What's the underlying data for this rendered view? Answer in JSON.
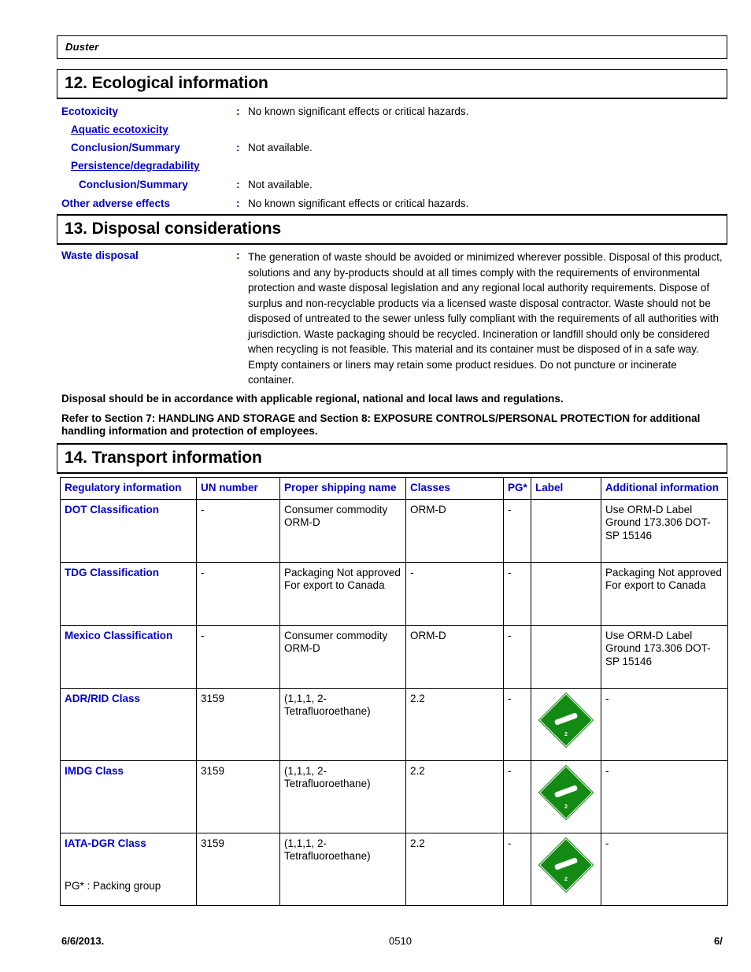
{
  "document": {
    "running_header_title": "Duster"
  },
  "sections": {
    "ecological": {
      "heading": "12. Ecological information",
      "rows": [
        {
          "label": "Ecotoxicity",
          "colon": ":",
          "value": "No known significant effects or critical hazards.",
          "level": 0,
          "underlined": false
        },
        {
          "label": "Aquatic ecotoxicity",
          "colon": "",
          "value": "",
          "level": 1,
          "underlined": true
        },
        {
          "label": "Conclusion/Summary",
          "colon": ":",
          "value": "Not available.",
          "level": 1,
          "underlined": false
        },
        {
          "label": "Persistence/degradability",
          "colon": "",
          "value": "",
          "level": 1,
          "underlined": true
        },
        {
          "label": "Conclusion/Summary",
          "colon": ":",
          "value": "Not available.",
          "level": 2,
          "underlined": false
        },
        {
          "label": "Other adverse effects",
          "colon": ":",
          "value": "No known significant effects or critical hazards.",
          "level": 0,
          "underlined": false
        }
      ]
    },
    "disposal": {
      "heading": "13. Disposal considerations",
      "waste_disposal_label": "Waste disposal",
      "waste_disposal_colon": ":",
      "waste_disposal_value": "The generation of waste should be avoided or minimized wherever possible.  Disposal of this product, solutions and any by-products should at all times comply with the requirements of environmental protection and waste disposal legislation and any regional local authority requirements.  Dispose of surplus and non-recyclable products via a licensed waste disposal contractor.  Waste should not be disposed of untreated to the sewer unless fully compliant with the requirements of all authorities with jurisdiction.  Waste packaging should be recycled.  Incineration or landfill should only be considered when recycling is not feasible.  This material and its container must be disposed of in a safe way.  Empty containers or liners may retain some product residues.  Do not puncture or incinerate container.",
      "note_1": "Disposal should be in accordance with applicable regional, national and local laws and regulations.",
      "note_2": "Refer to Section 7: HANDLING AND STORAGE and Section 8: EXPOSURE CONTROLS/PERSONAL PROTECTION for additional handling information and protection of employees."
    },
    "transport": {
      "heading": "14. Transport information",
      "columns": [
        "Regulatory information",
        "UN number",
        "Proper shipping name",
        "Classes",
        "PG*",
        "Label",
        "Additional information"
      ],
      "rows": [
        {
          "regulatory": "DOT Classification",
          "un_number": "-",
          "shipping_name": "Consumer commodity ORM-D",
          "classes": "ORM-D",
          "pg": "-",
          "label": "",
          "additional": "Use ORM-D Label Ground 173.306 DOT-SP 15146"
        },
        {
          "regulatory": "TDG Classification",
          "un_number": "-",
          "shipping_name": "Packaging Not approved For export to Canada",
          "classes": "-",
          "pg": "-",
          "label": "",
          "additional": "Packaging Not approved For export to Canada"
        },
        {
          "regulatory": "Mexico Classification",
          "un_number": "-",
          "shipping_name": "Consumer commodity ORM-D",
          "classes": "ORM-D",
          "pg": "-",
          "label": "",
          "additional": "Use ORM-D Label Ground 173.306 DOT-SP 15146"
        },
        {
          "regulatory": "ADR/RID Class",
          "un_number": "3159",
          "shipping_name": " (1,1,1, 2-Tetrafluoroethane)",
          "classes": "2.2",
          "pg": "-",
          "label": "placard-class-2-2",
          "additional": "-"
        },
        {
          "regulatory": "IMDG Class",
          "un_number": "3159",
          "shipping_name": " (1,1,1, 2-Tetrafluoroethane)",
          "classes": "2.2",
          "pg": "-",
          "label": "placard-class-2-2",
          "additional": "-"
        },
        {
          "regulatory": "IATA-DGR Class",
          "un_number": "3159",
          "shipping_name": " (1,1,1, 2-Tetrafluoroethane)",
          "classes": "2.2",
          "pg": "-",
          "label": "placard-class-2-2",
          "additional": "-"
        }
      ],
      "placard": {
        "icon": "non-flammable-gas-diamond-icon",
        "number": "2",
        "color": "#138A13"
      },
      "footnote": "PG* : Packing group"
    }
  },
  "footer": {
    "date": "6/6/2013.",
    "code": "0510",
    "page": "6/"
  },
  "colors": {
    "heading_blue": "#0000CC",
    "placard_green": "#138A13",
    "text_black": "#000000"
  }
}
